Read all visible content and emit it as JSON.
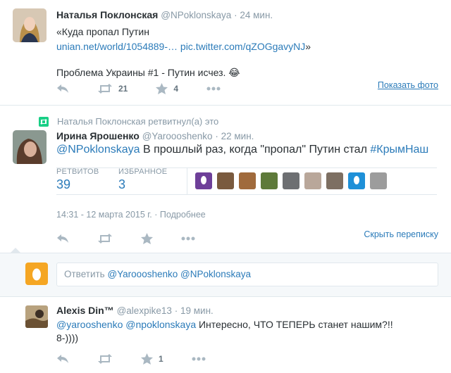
{
  "tweet1": {
    "name": "Наталья Поклонская",
    "handle": "@NPoklonskaya",
    "time": "· 24 мин.",
    "line1": "«Куда пропал Путин",
    "link1": "unian.net/world/1054889-…",
    "link2": "pic.twitter.com/qZOGgavyNJ",
    "close_quote": "»",
    "line2": "Проблема Украины #1 - Путин исчез. 😂",
    "retweets": "21",
    "favorites": "4",
    "show_photo": "Показать фото"
  },
  "retweet_notice": "Наталья Поклонская ретвитнул(а) это",
  "tweet2": {
    "name": "Ирина Ярошенко",
    "handle": "@Yaroooshenko",
    "time": "· 22 мин.",
    "mention": "@NPoklonskaya",
    "text": " В прошлый раз, когда \"пропал\" Путин стал ",
    "hashtag": "#КрымНаш",
    "stats": {
      "retweets_label": "РЕТВИТОВ",
      "retweets": "39",
      "favorites_label": "ИЗБРАННОЕ",
      "favorites": "3"
    },
    "timestamp": "14:31 - 12 марта 2015 г.",
    "details": "· Подробнее",
    "hide_conversation": "Скрыть переписку"
  },
  "reply": {
    "placeholder_prefix": "Ответить ",
    "mention1": "@Yaroooshenko",
    "mention2": "@NPoklonskaya"
  },
  "tweet3": {
    "name": "Alexis Din™",
    "handle": "@alexpike13",
    "time": "· 19 мин.",
    "mention1": "@yarooshenko",
    "mention2": "@npoklonskaya",
    "text": " Интересно,  ЧТО ТЕПЕРЬ станет нашим?!!",
    "line2": "8-))))",
    "favorites": "1"
  },
  "colors": {
    "link": "#2b7bb9",
    "muted": "#8899a6",
    "retweet_green": "#19cf86",
    "reply_box_orange": "#f5a623",
    "purple_egg": "#6e3f99",
    "blue_egg": "#1e90d8"
  }
}
